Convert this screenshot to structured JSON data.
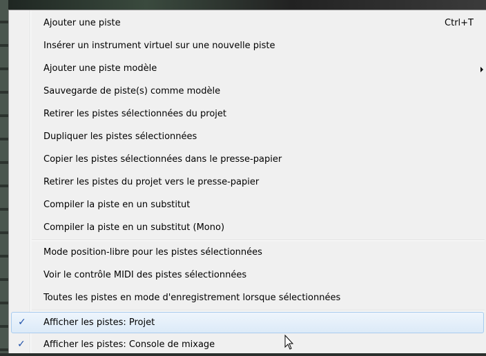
{
  "menu": {
    "items": [
      {
        "label": "Ajouter une piste",
        "shortcut": "Ctrl+T"
      },
      {
        "label": "Insérer un instrument virtuel sur une nouvelle piste"
      },
      {
        "label": "Ajouter une piste modèle",
        "submenu": true
      },
      {
        "label": "Sauvegarde de piste(s) comme modèle"
      },
      {
        "label": "Retirer les pistes sélectionnées du projet"
      },
      {
        "label": "Dupliquer les pistes sélectionnées"
      },
      {
        "label": "Copier les pistes sélectionnées dans le presse-papier"
      },
      {
        "label": "Retirer les pistes du projet vers le presse-papier"
      },
      {
        "label": "Compiler la piste en un substitut"
      },
      {
        "label": "Compiler la piste en un substitut (Mono)"
      },
      {
        "label": "Mode position-libre pour les pistes sélectionnées"
      },
      {
        "label": "Voir le contrôle MIDI des pistes sélectionnées"
      },
      {
        "label": "Toutes les pistes en mode d'enregistrement lorsque sélectionnées"
      },
      {
        "label": "Afficher les pistes: Projet",
        "checked": true,
        "highlighted": true
      },
      {
        "label": "Afficher les pistes: Console de mixage",
        "checked": true
      }
    ],
    "check_glyph": "✓",
    "colors": {
      "menu_bg": "#f0f0f0",
      "highlight_border": "#a8cbef",
      "check_color": "#1d4fa8"
    }
  }
}
